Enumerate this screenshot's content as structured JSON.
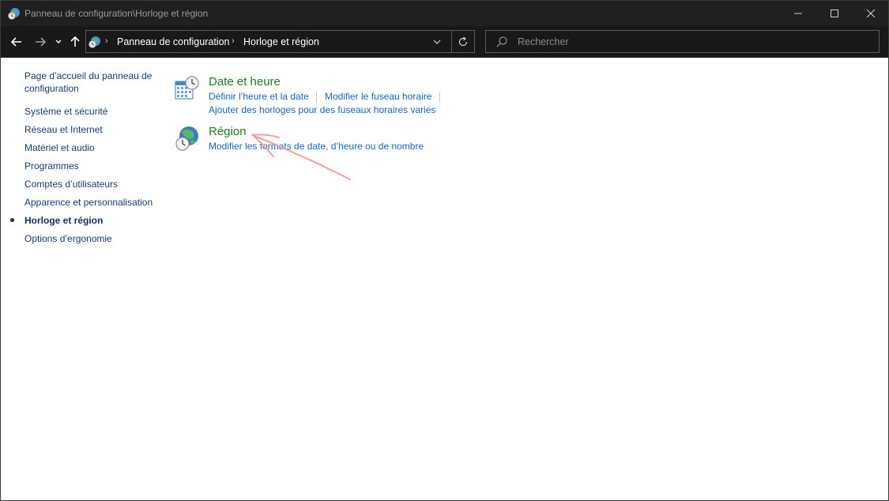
{
  "window": {
    "title": "Panneau de configuration\\Horloge et région"
  },
  "nav": {
    "breadcrumbs": [
      "Panneau de configuration",
      "Horloge et région"
    ],
    "search_placeholder": "Rechercher"
  },
  "sidebar": {
    "home": "Page d’accueil du panneau de configuration",
    "items": [
      {
        "label": "Système et sécurité"
      },
      {
        "label": "Réseau et Internet"
      },
      {
        "label": "Matériel et audio"
      },
      {
        "label": "Programmes"
      },
      {
        "label": "Comptes d’utilisateurs"
      },
      {
        "label": "Apparence et personnalisation"
      },
      {
        "label": "Horloge et région",
        "active": true
      },
      {
        "label": "Options d’ergonomie"
      }
    ]
  },
  "main": {
    "categories": [
      {
        "title": "Date et heure",
        "icon": "calendar-clock-icon",
        "links": [
          "Définir l’heure et la date",
          "Modifier le fuseau horaire",
          "Ajouter des horloges pour des fuseaux horaires variés"
        ]
      },
      {
        "title": "Région",
        "icon": "globe-clock-icon",
        "links": [
          "Modifier les formats de date, d’heure ou de nombre"
        ]
      }
    ]
  },
  "colors": {
    "titlebar": "#202020",
    "navbar": "#191919",
    "category_title": "#1e7a1e",
    "link": "#1565c0",
    "sidebar_text": "#1a3a6e",
    "annotation": "#f0a0a0"
  }
}
